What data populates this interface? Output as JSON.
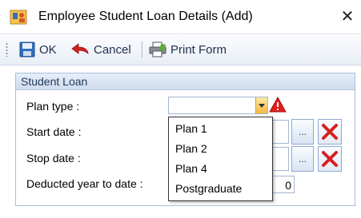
{
  "window": {
    "title": "Employee Student Loan Details (Add)",
    "close_glyph": "✕"
  },
  "toolbar": {
    "ok_label": "OK",
    "cancel_label": "Cancel",
    "print_label": "Print Form"
  },
  "group": {
    "title": "Student Loan"
  },
  "fields": {
    "plan_type_label": "Plan type :",
    "start_date_label": "Start date :",
    "stop_date_label": "Stop date :",
    "deducted_label": "Deducted year to date :",
    "deducted_value": "0",
    "plan_type_value": ""
  },
  "dropdown": {
    "options": [
      "Plan 1",
      "Plan 2",
      "Plan 4",
      "Postgraduate"
    ]
  },
  "buttons": {
    "ellipsis": "..."
  },
  "colors": {
    "accent_border": "#a9bfdb",
    "warning_red": "#e02020",
    "clear_red": "#d42020"
  }
}
